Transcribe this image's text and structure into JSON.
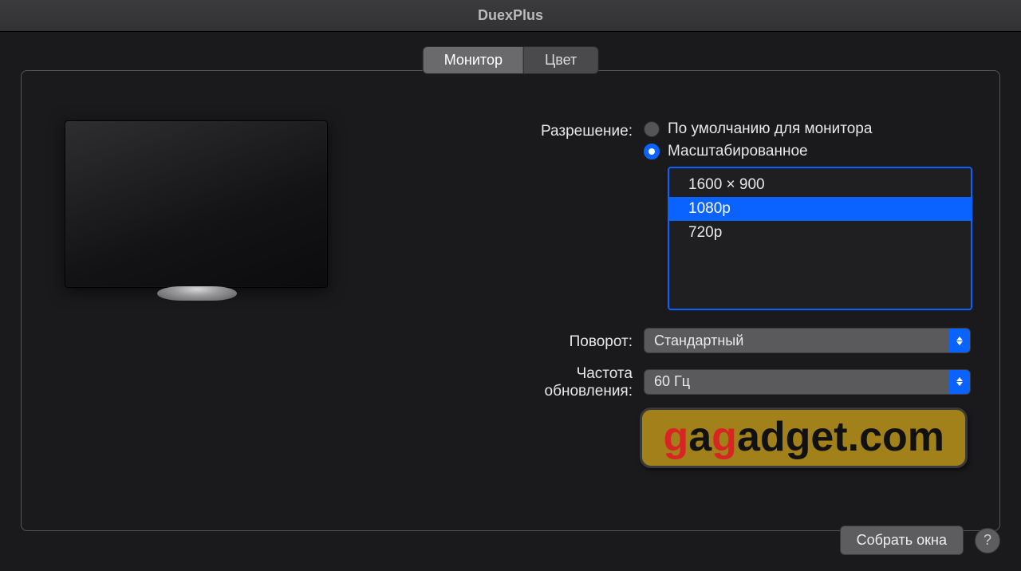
{
  "window": {
    "title": "DuexPlus"
  },
  "tabs": {
    "monitor": "Монитор",
    "color": "Цвет"
  },
  "labels": {
    "resolution": "Разрешение:",
    "rotation": "Поворот:",
    "refresh": "Частота обновления:"
  },
  "resolution": {
    "default_label": "По умолчанию для монитора",
    "scaled_label": "Масштабированное",
    "options": [
      "1600 × 900",
      "1080p",
      "720p"
    ],
    "selected": "1080p"
  },
  "rotation": {
    "value": "Стандартный"
  },
  "refresh": {
    "value": "60 Гц"
  },
  "buttons": {
    "gather": "Собрать окна",
    "help": "?"
  },
  "watermark": {
    "part1": "g",
    "part2": "a",
    "part3": "g",
    "rest": "adget.com"
  }
}
